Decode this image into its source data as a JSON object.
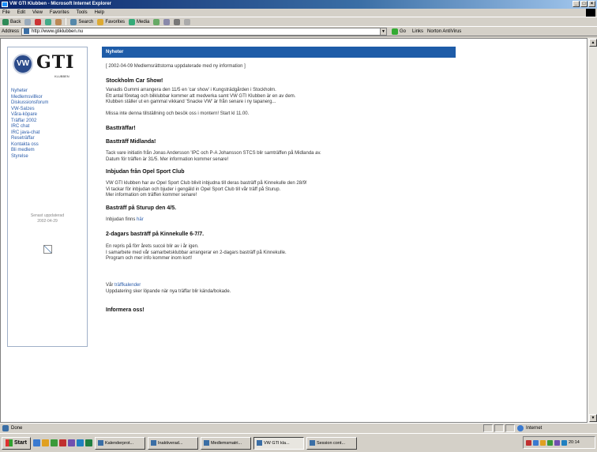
{
  "window": {
    "title": "VW GTI Klubben - Microsoft Internet Explorer",
    "buttons": [
      "_",
      "□",
      "×"
    ]
  },
  "menu": [
    "File",
    "Edit",
    "View",
    "Favorites",
    "Tools",
    "Help"
  ],
  "toolbar": {
    "back": "Back",
    "search": "Search",
    "favorites": "Favorites",
    "media": "Media"
  },
  "address": {
    "label": "Address",
    "url": "http://www.gtiklubben.nu",
    "go": "Go",
    "links": [
      "Links",
      "Norton AntiVirus"
    ]
  },
  "sidebar": {
    "logo_text": "GTI",
    "logo_badge": "VW",
    "logo_sub": "KLUBBEN",
    "nav": [
      "Nyheter",
      "Medlemsvillkor",
      "Diskussionsforum",
      "VW-Salzes",
      "Våra-köpare",
      "Träffar 2002",
      "IRC chat",
      "IRC java-chat",
      "Reseträffar",
      "Kontakta oss",
      "Bli medlem",
      "Styrelse"
    ],
    "updated_label": "Senast uppdaterad",
    "updated_date": "2002-04-29"
  },
  "main": {
    "header": "Nyheter",
    "items": [
      "[ 2002-04-09 Medlemsrättstorna uppdaterade med ny information ]",
      "Stockholm Car Show!",
      "Vanadis Gummi arrangera den 11/5 en 'car show' i Kungsträdgården i Stockholm.",
      "Ett antal företag och bilklubbar kommer att medverka samt VW GTI Klubben är en av dem.",
      "Klubben ställer ut en gammal vikkand 'Snacke VW' är från senare i ny tapanerg...",
      "Missa inte denna tillställning och besök oss i montern! Start kl 11.00.",
      "Bastträffar!",
      "Bastträff Midlanda!",
      "Tack vare initiatin från Jonas Andersson 'IPC och P-A Johansson STCS blir samträffen på Midlanda av.",
      "Datum för träffen är 31/5. Mer information kommer senare!",
      "Inbjudan från Opel Sport Club",
      "VW GTI klubben har av Opel Sport Club blivit inbjudna till deras basträff på Kinnekulle den 28/9!",
      "Vi tackar för inbjudan och bjuder i gengäld in Opel Sport Club till vår träff på Sturup.",
      "Mer information om träffen kommer senare!",
      "Basträff på Sturup den 4/5.",
      "Inbjudan finns",
      "här",
      "2-dagars basträff på Kinnekulle 6-7/7.",
      "En repris på förr årets succé blir av i år igen.",
      "I samarbete med vår samarbetsklubbar arrangerar en 2-dagars basträff på Kinnekulle.",
      "Program och mer info kommer inom kort!",
      "Vår",
      "träffkalender",
      "Uppdatering sker löpande när nya träffar blir kända/bokade.",
      "Informera oss!"
    ]
  },
  "status": {
    "left": "Done",
    "zone": "Internet"
  },
  "taskbar": {
    "start": "Start",
    "tasks": [
      "Kalenderprot...",
      "Inaktiverad...",
      "Medlemsmatri...",
      "VW GTI kla...",
      "Session cont..."
    ],
    "clock": "20:14"
  }
}
